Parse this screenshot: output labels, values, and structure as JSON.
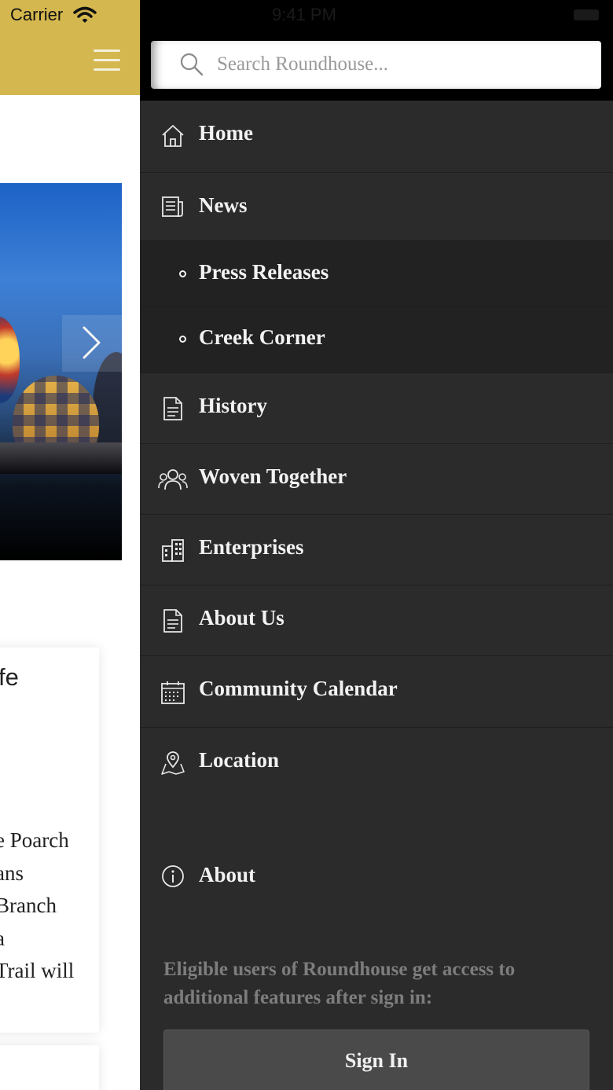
{
  "status_bar": {
    "carrier": "Carrier",
    "time": "9:41 PM"
  },
  "background_app": {
    "card_title": "fe",
    "card_lines": [
      "e Poarch",
      "ans",
      "Branch",
      "a",
      "Trail will"
    ]
  },
  "drawer": {
    "search": {
      "placeholder": "Search Roundhouse...",
      "value": ""
    },
    "menu": [
      {
        "label": "Home",
        "icon": "home-icon",
        "type": "main"
      },
      {
        "label": "News",
        "icon": "newspaper-icon",
        "type": "main"
      },
      {
        "label": "Press Releases",
        "type": "sub"
      },
      {
        "label": "Creek Corner",
        "type": "sub"
      },
      {
        "label": "History",
        "icon": "document-icon",
        "type": "main"
      },
      {
        "label": "Woven Together",
        "icon": "people-icon",
        "type": "main"
      },
      {
        "label": "Enterprises",
        "icon": "buildings-icon",
        "type": "main"
      },
      {
        "label": "About Us",
        "icon": "document-icon",
        "type": "main"
      },
      {
        "label": "Community Calendar",
        "icon": "calendar-icon",
        "type": "main"
      },
      {
        "label": "Location",
        "icon": "map-pin-icon",
        "type": "main"
      }
    ],
    "about": {
      "label": "About",
      "icon": "info-icon"
    },
    "signin_note": "Eligible users of Roundhouse get access to additional features after sign in:",
    "signin_button": "Sign In"
  },
  "colors": {
    "header_gold": "#d4b74e",
    "drawer_bg": "#2b2b2b",
    "submenu_bg": "#222222",
    "signin_bg": "#4a4a4a"
  }
}
